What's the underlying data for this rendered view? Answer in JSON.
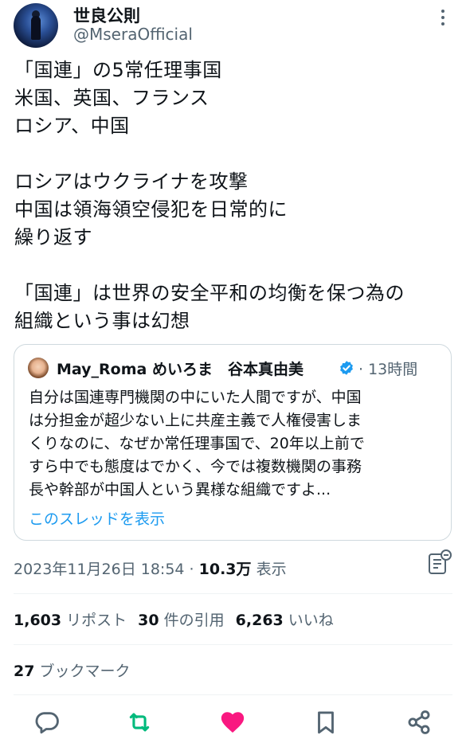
{
  "author": {
    "display_name": "世良公則",
    "handle": "@MseraOfficial"
  },
  "tweet": {
    "text": "「国連」の5常任理事国\n米国、英国、フランス\nロシア、中国\n\nロシアはウクライナを攻撃\n中国は領海領空侵犯を日常的に\n繰り返す\n\n「国連」は世界の安全平和の均衡を保つ為の\n組織という事は幻想"
  },
  "quote": {
    "name": "May_Roma めいろま　谷本真由美",
    "time": "· 13時間",
    "text": "自分は国連専門機関の中にいた人間ですが、中国\nは分担金が超少ない上に共産主義で人権侵害しま\nくりなのに、なぜか常任理事国で、20年以上前で\nすら中でも態度はでかく、今では複数機関の事務\n長や幹部が中国人という異様な組織ですよ...",
    "show_thread": "このスレッドを表示"
  },
  "meta": {
    "timestamp": "2023年11月26日 18:54",
    "separator": " · ",
    "views_count": "10.3万",
    "views_label": " 表示"
  },
  "stats": {
    "reposts_count": "1,603",
    "reposts_label": " リポスト",
    "quotes_count": "30",
    "quotes_label": " 件の引用",
    "likes_count": "6,263",
    "likes_label": " いいね"
  },
  "bookmarks": {
    "count": "27",
    "label": " ブックマーク"
  },
  "icons": {
    "reply": "reply-icon",
    "repost": "repost-icon",
    "like": "heart-icon",
    "bookmark": "bookmark-icon",
    "share": "share-icon",
    "notes": "community-notes-icon",
    "more": "more-icon",
    "verified": "verified-badge-icon"
  },
  "colors": {
    "repost_green": "#00ba7c",
    "like_pink": "#f91880",
    "link_blue": "#1d9bf0",
    "secondary_text": "#536471"
  }
}
